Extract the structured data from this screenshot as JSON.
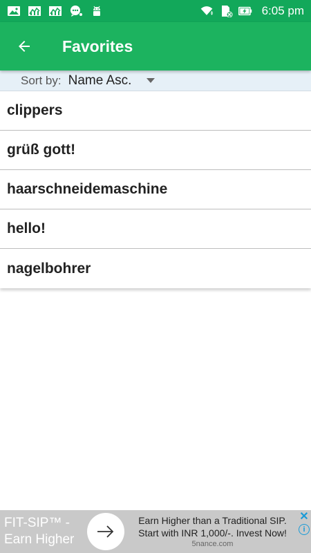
{
  "status_bar": {
    "time": "6:05 pm",
    "left_icons": [
      "image-icon",
      "chart-icon",
      "chart-icon",
      "message-icon",
      "android-icon"
    ],
    "right_icons": [
      "wifi-icon",
      "sd-card-icon",
      "battery-charging-icon"
    ]
  },
  "app_bar": {
    "title": "Favorites",
    "back_icon": "arrow-left-icon",
    "background": "#1cb35f"
  },
  "sort": {
    "label": "Sort by:",
    "selected": "Name Asc."
  },
  "favorites": [
    {
      "text": "clippers"
    },
    {
      "text": "grüß gott!"
    },
    {
      "text": "haarschneidemaschine"
    },
    {
      "text": "hello!"
    },
    {
      "text": "nagelbohrer"
    }
  ],
  "ad": {
    "brand_line1": "FIT-SIP™ -",
    "brand_line2": "Earn Higher",
    "copy_line1": "Earn Higher than a Traditional SIP.",
    "copy_line2": "Start with INR 1,000/-. Invest Now!",
    "domain": "5nance.com",
    "close_label": "✕",
    "info_label": "i"
  },
  "colors": {
    "status_bar": "#12a85a",
    "app_bar": "#1cb35f",
    "sort_bar": "#e6f0f7",
    "ad_background": "#c9c9c9"
  }
}
